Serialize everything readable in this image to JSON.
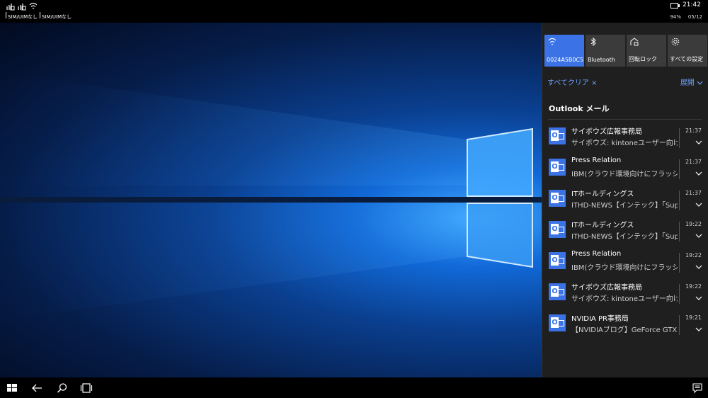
{
  "status_bar": {
    "sim_slots": [
      {
        "label": "SIM/UIMなし"
      },
      {
        "label": "SIM/UIMなし"
      }
    ],
    "time": "21:42",
    "battery": "94%",
    "date": "05/12"
  },
  "quick_actions": [
    {
      "label": "0024A5B0C57",
      "icon": "wifi-icon",
      "active": true
    },
    {
      "label": "Bluetooth",
      "icon": "bluetooth-icon",
      "active": false
    },
    {
      "label": "回転ロック",
      "icon": "rotation-lock-icon",
      "active": false
    },
    {
      "label": "すべての設定",
      "icon": "gear-icon",
      "active": false
    }
  ],
  "action_center": {
    "clear_all": "すべてクリア ×",
    "expand": "展開",
    "group_title": "Outlook メール"
  },
  "notifications": [
    {
      "title": "サイボウズ広報事務局",
      "body": "サイボウズ: kintoneユーザー向けイ",
      "time": "21:37"
    },
    {
      "title": "Press Relation",
      "body": "IBM(クラウド環境向けにフラッシュ",
      "time": "21:37"
    },
    {
      "title": "ITホールディングス",
      "body": "ITHD-NEWS【インテック】「Super:",
      "time": "21:37"
    },
    {
      "title": "ITホールディングス",
      "body": "ITHD-NEWS【インテック】「Super:",
      "time": "19:22"
    },
    {
      "title": "Press Relation",
      "body": "IBM(クラウド環境向けにフラッシュ",
      "time": "19:22"
    },
    {
      "title": "サイボウズ広報事務局",
      "body": "サイボウズ: kintoneユーザー向けイ",
      "time": "19:22"
    },
    {
      "title": "NVIDIA PR事務局",
      "body": "【NVIDIAブログ】GeForce GTX 1(",
      "time": "19:21"
    }
  ],
  "colors": {
    "accent": "#3b73e6",
    "link": "#6ea4ff",
    "panel_bg": "#1f1f1f",
    "tile_bg": "#3b3b3b"
  }
}
